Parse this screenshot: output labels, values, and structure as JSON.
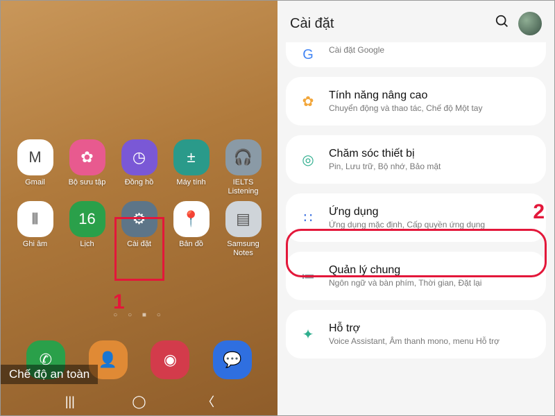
{
  "left": {
    "apps": [
      {
        "label": "Gmail",
        "glyph": "M",
        "cls": "c-white"
      },
      {
        "label": "Bộ sưu tập",
        "glyph": "✿",
        "cls": "c-pink"
      },
      {
        "label": "Đồng hồ",
        "glyph": "◷",
        "cls": "c-purple"
      },
      {
        "label": "Máy tính",
        "glyph": "±",
        "cls": "c-teal"
      },
      {
        "label": "IELTS\nListening",
        "glyph": "🎧",
        "cls": "c-grey"
      },
      {
        "label": "Ghi âm",
        "glyph": "⦀",
        "cls": "c-white"
      },
      {
        "label": "Lịch",
        "glyph": "16",
        "cls": "c-green"
      },
      {
        "label": "Cài đặt",
        "glyph": "⚙",
        "cls": "c-slate"
      },
      {
        "label": "Bản đồ",
        "glyph": "📍",
        "cls": "c-white"
      },
      {
        "label": "Samsung\nNotes",
        "glyph": "▤",
        "cls": "c-lgrey"
      }
    ],
    "dock": [
      {
        "glyph": "✆",
        "cls": "c-phone"
      },
      {
        "glyph": "👤",
        "cls": "c-orange"
      },
      {
        "glyph": "◉",
        "cls": "c-red"
      },
      {
        "glyph": "💬",
        "cls": "c-blue"
      }
    ],
    "safemode_label": "Chế độ an toàn",
    "step_number": "1"
  },
  "right": {
    "header_title": "Cài đặt",
    "items": [
      {
        "title": "",
        "sub": "Cài đặt Google",
        "icon": "G",
        "color": "#4285F4",
        "top_cut": true
      },
      {
        "title": "Tính năng nâng cao",
        "sub": "Chuyển động và thao tác, Chế độ Một tay",
        "icon": "✿",
        "color": "#f2a63a"
      },
      {
        "title": "Chăm sóc thiết bị",
        "sub": "Pin, Lưu trữ, Bộ nhớ, Bảo mật",
        "icon": "◎",
        "color": "#2fae8e"
      },
      {
        "title": "Ứng dụng",
        "sub": "Ứng dụng mặc định, Cấp quyền ứng dụng",
        "icon": "∷",
        "color": "#3a6fe0"
      },
      {
        "title": "Quản lý chung",
        "sub": "Ngôn ngữ và bàn phím, Thời gian, Đặt lại",
        "icon": "≔",
        "color": "#8a8f96"
      },
      {
        "title": "Hỗ trợ",
        "sub": "Voice Assistant, Âm thanh mono, menu Hỗ trợ",
        "icon": "✦",
        "color": "#2fae8e"
      }
    ],
    "step_number": "2"
  }
}
